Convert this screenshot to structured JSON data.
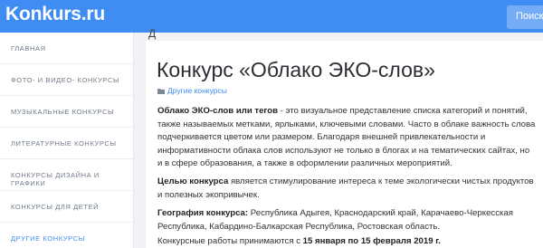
{
  "site": {
    "logo": "Konkurs.ru"
  },
  "search": {
    "label": "Поиск"
  },
  "breadcrumb": {
    "fragment": "Д"
  },
  "sidebar": {
    "items": [
      {
        "label": "ГЛАВНАЯ",
        "active": false
      },
      {
        "label": "ФОТО- И ВИДЕО- КОНКУРСЫ",
        "active": false
      },
      {
        "label": "МУЗЫКАЛЬНЫЕ КОНКУРСЫ",
        "active": false
      },
      {
        "label": "ЛИТЕРАТУРНЫЕ КОНКУРСЫ",
        "active": false
      },
      {
        "label": "КОНКУРСЫ ДИЗАЙНА И ГРАФИКИ",
        "active": false
      },
      {
        "label": "КОНКУРСЫ ДЛЯ ДЕТЕЙ",
        "active": false
      },
      {
        "label": "ДРУГИЕ КОНКУРСЫ",
        "active": true
      }
    ]
  },
  "article": {
    "title": "Конкурс «Облако ЭКО-слов»",
    "category": {
      "icon": "folder-icon",
      "label": "Другие конкурсы"
    },
    "p1_bold": "Облако ЭКО-слов или тегов",
    "p1_text": " - это визуальное представление списка категорий и понятий, также называемых метками, ярлыками, ключевыми словами. Часто в облаке важность слова подчеркивается цветом или размером. Благодаря внешней привлекательности и информативности облака слов используют не только в блогах и на тематических сайтах, но и в сфере образования, а также в оформлении различных мероприятий.",
    "p2_bold": "Целью конкурса",
    "p2_text": " является стимулирование интереса к теме экологически чистых продуктов и полезных экопривычек.",
    "p3_bold": "География конкурса:",
    "p3_text": " Республика Адыгея, Краснодарский край, Карачаево-Черкесская Республика, Кабардино-Балкарская Республика, Ростовская область.",
    "p4_text": "Конкурсные работы принимаются с ",
    "p4_bold": "15 января по 15 февраля 2019 г."
  },
  "colors": {
    "accent": "#3f8cf2",
    "text": "#333333",
    "muted": "#6f7a87",
    "background": "#f1f3f5"
  }
}
